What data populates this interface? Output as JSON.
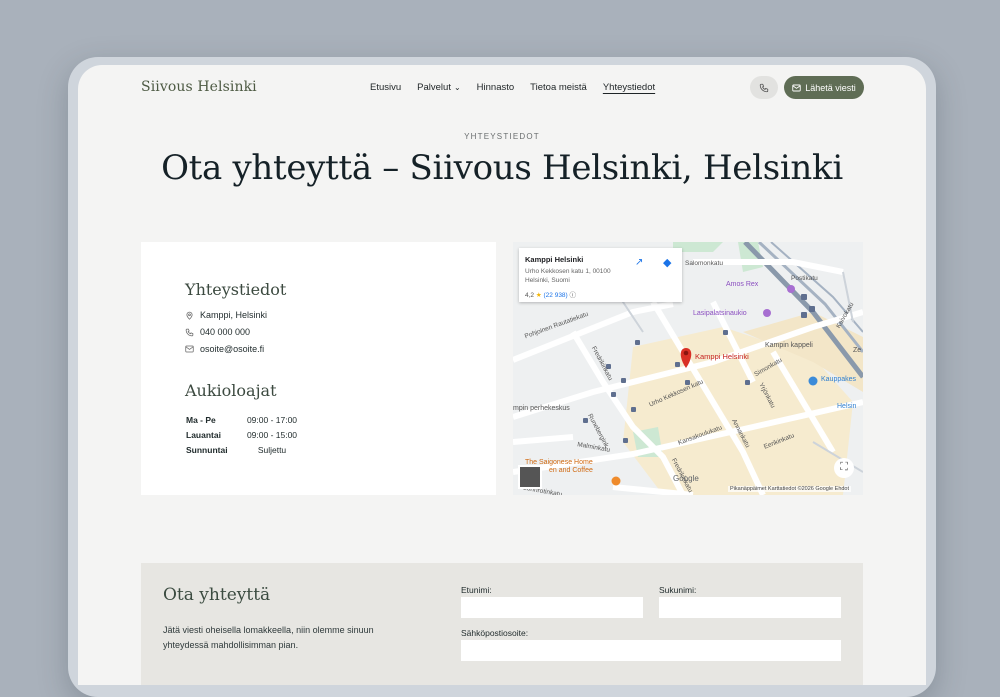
{
  "header": {
    "logo": "Siivous Helsinki",
    "nav": [
      {
        "label": "Etusivu"
      },
      {
        "label": "Palvelut",
        "has_dropdown": true
      },
      {
        "label": "Hinnasto"
      },
      {
        "label": "Tietoa meistä"
      },
      {
        "label": "Yhteystiedot",
        "active": true
      }
    ],
    "send_button": "Lähetä viesti"
  },
  "hero": {
    "eyebrow": "YHTEYSTIEDOT",
    "title": "Ota yhteyttä – Siivous Helsinki, Helsinki"
  },
  "contact": {
    "heading": "Yhteystiedot",
    "address": "Kamppi, Helsinki",
    "phone": "040 000 000",
    "email": "osoite@osoite.fi"
  },
  "hours": {
    "heading": "Aukioloajat",
    "rows": [
      {
        "day": "Ma - Pe",
        "time": "09:00 - 17:00"
      },
      {
        "day": "Lauantai",
        "time": "09:00 - 15:00"
      },
      {
        "day": "Sunnuntai",
        "time": "Suljettu"
      }
    ]
  },
  "map": {
    "place_name": "Kamppi Helsinki",
    "address": "Urho Kekkosen katu 1, 00100 Helsinki, Suomi",
    "rating": "4,2",
    "reviews": "(22 938)",
    "marker_label": "Kamppi Helsinki",
    "streets": {
      "s1": "Salomonkatu",
      "s2": "Postikatu",
      "s3": "Kaivokatu",
      "s4": "Pohjoinen Rautatiekatu",
      "s5": "Fredrikinkatu",
      "s6": "Runebergink.",
      "s7": "Urho Kekkosen katu",
      "s8": "Simonkatu",
      "s9": "Yrjönkatu",
      "s10": "Annankatu",
      "s11": "Kansakoulukatu",
      "s12": "Eerikinkatu",
      "s13": "Malminkatu",
      "s14": "Fredrikinkatu",
      "s15": "Lapinlahdenkatu",
      "s16": "Salomonkatu",
      "s17": "Lönnrotinkatu"
    },
    "pois": {
      "amos": "Amos Rex",
      "lasi": "Lasipalatsinaukio",
      "kappeli": "Kampin kappeli",
      "kauppa": "Kauppakes",
      "helsin": "Helsin",
      "perhe": "mpin perhekeskus",
      "saigon1": "The Saigonese Home",
      "saigon2": "en and Coffee",
      "ze": "Ze"
    },
    "google": "Google",
    "footer": "Pikanäppäimet  Karttatiedot ©2026 Google  Ehdot"
  },
  "form": {
    "heading": "Ota yhteyttä",
    "description": "Jätä viesti oheisella lomakkeella, niin olemme sinuun yhteydessä mahdollisimman pian.",
    "first_name_label": "Etunimi:",
    "last_name_label": "Sukunimi:",
    "email_label": "Sähköpostiosoite:"
  },
  "colors": {
    "accent": "#5f6d55",
    "background": "#f4f4f3",
    "form_bg": "#e7e6e2",
    "map_marker": "#d93025"
  }
}
